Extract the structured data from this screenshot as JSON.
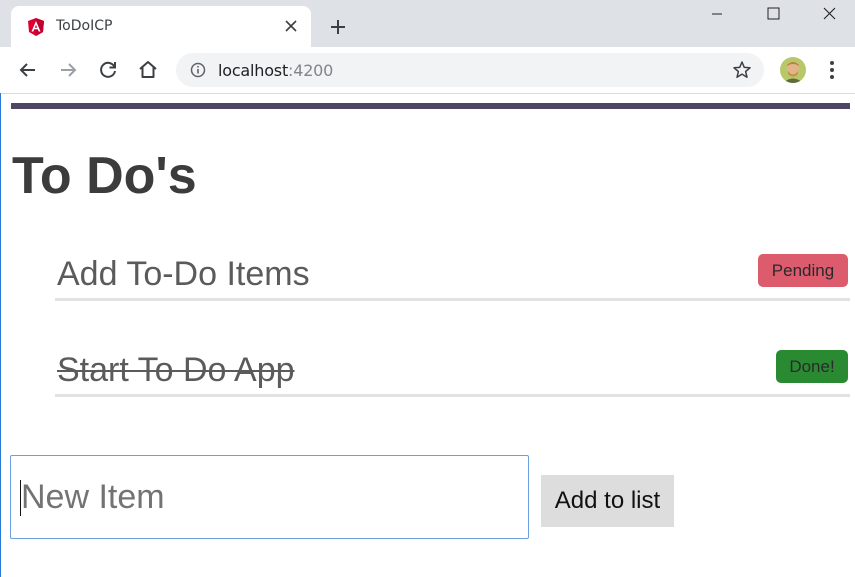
{
  "browser": {
    "tab_title": "ToDoICP",
    "url_host": "localhost",
    "url_port": ":4200",
    "icons": [
      "angular-favicon",
      "close-icon",
      "plus-icon",
      "minimize-icon",
      "maximize-icon",
      "window-close-icon",
      "back-icon",
      "forward-icon",
      "reload-icon",
      "home-icon",
      "info-icon",
      "star-icon",
      "avatar",
      "kebab-menu-icon"
    ]
  },
  "page": {
    "title": "To Do's",
    "accent_color": "#4f4565",
    "todos": [
      {
        "text": "Add To-Do Items",
        "status": "Pending",
        "status_color": "#dc5b6d",
        "completed": false
      },
      {
        "text": "Start To Do App",
        "status": "Done!",
        "status_color": "#298a32",
        "completed": true
      }
    ],
    "new_item": {
      "placeholder": "New Item",
      "value": "",
      "button_label": "Add to list"
    }
  }
}
